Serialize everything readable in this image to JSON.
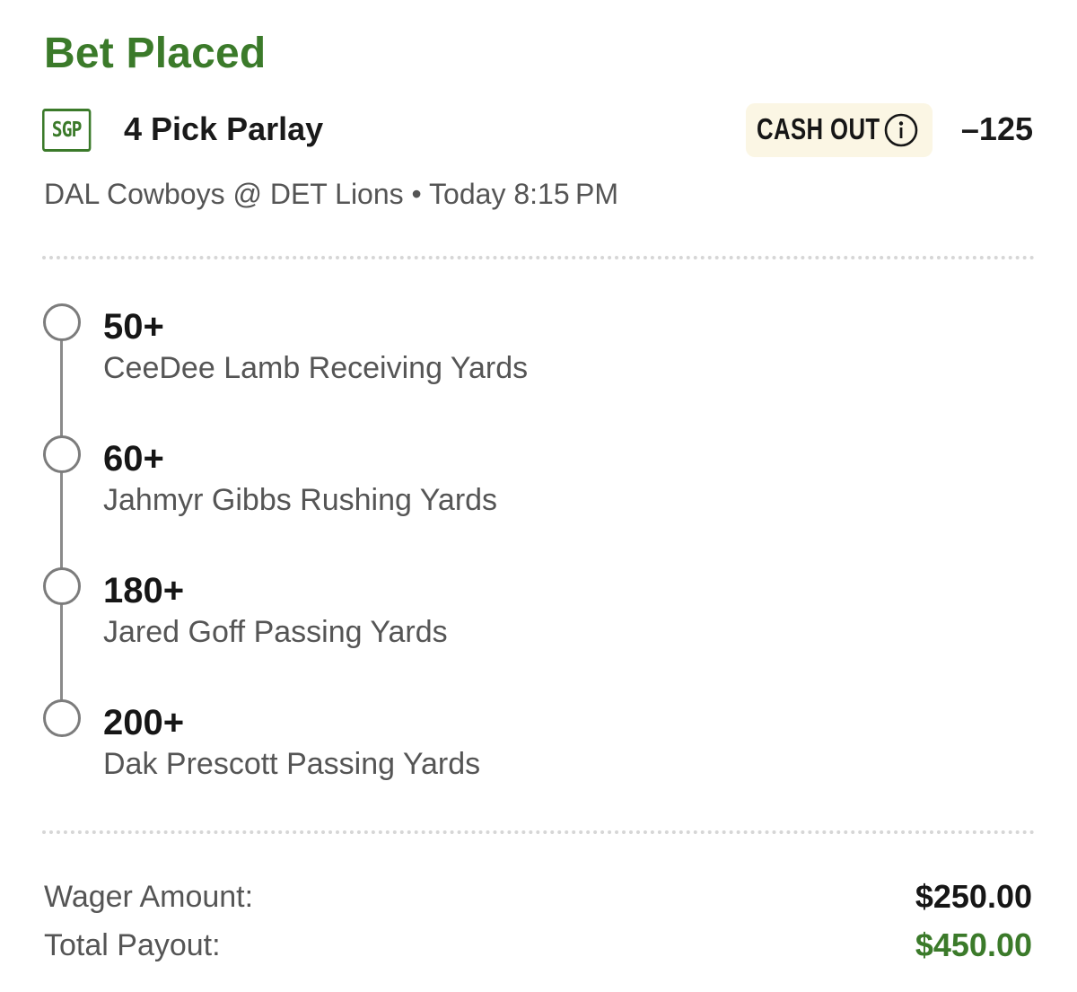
{
  "header": {
    "status_title": "Bet Placed"
  },
  "bet": {
    "badge": "SGP",
    "type": "4 Pick Parlay",
    "cash_out_label": "CASH OUT",
    "odds": "–125",
    "game": "DAL Cowboys @ DET Lions • Today 8:15 PM"
  },
  "legs": [
    {
      "line": "50+",
      "market": "CeeDee Lamb Receiving Yards"
    },
    {
      "line": "60+",
      "market": "Jahmyr Gibbs Rushing Yards"
    },
    {
      "line": "180+",
      "market": "Jared Goff Passing Yards"
    },
    {
      "line": "200+",
      "market": "Dak Prescott Passing Yards"
    }
  ],
  "summary": {
    "wager_label": "Wager Amount:",
    "wager_value": "$250.00",
    "payout_label": "Total Payout:",
    "payout_value": "$450.00"
  },
  "icons": {
    "info": "info-icon",
    "leg_status": "empty-circle-icon"
  },
  "colors": {
    "accent_green": "#3b7a2a",
    "cash_out_bg": "#fbf6e4",
    "secondary_text": "#555555",
    "timeline_gray": "#8a8a8a"
  }
}
